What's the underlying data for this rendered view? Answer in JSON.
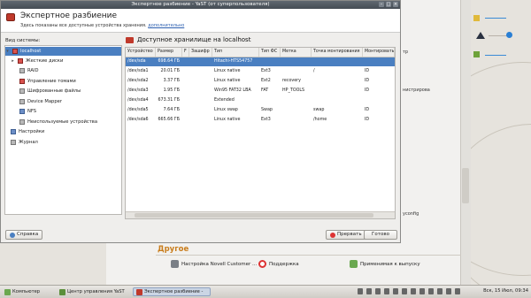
{
  "dialog": {
    "window_title": "Экспертное разбиение - YaST (от суперпользователя)",
    "header_title": "Экспертное разбиение",
    "header_desc": "Здесь показаны все доступные устройства хранения.",
    "header_link": "дополнительно"
  },
  "sidebar": {
    "label": "Вид системы:",
    "items": [
      {
        "label": "localhost"
      },
      {
        "label": "Жесткие диски"
      },
      {
        "label": "RAID"
      },
      {
        "label": "Управление томами"
      },
      {
        "label": "Шифрованные файлы"
      },
      {
        "label": "Device Mapper"
      },
      {
        "label": "NFS"
      },
      {
        "label": "Неиспользуемые устройства"
      },
      {
        "label": "Настройки"
      },
      {
        "label": "Журнал"
      }
    ]
  },
  "panel": {
    "title": "Доступное хранилище на localhost",
    "columns": [
      "Устройство",
      "Размер",
      "F",
      "Зашифр",
      "Тип",
      "Тип ФС",
      "Метка",
      "Точка монтирования",
      "Монтировать по"
    ],
    "rows": [
      {
        "device": "/dev/sda",
        "size": "698.64 ГБ",
        "type": "Hitachi-HTS54757",
        "fs": "",
        "label": "",
        "mount": "",
        "by": ""
      },
      {
        "device": "/dev/sda1",
        "size": "20.01 ГБ",
        "type": "Linux native",
        "fs": "Ext3",
        "label": "",
        "mount": "/",
        "by": "ID"
      },
      {
        "device": "/dev/sda2",
        "size": "3.37 ГБ",
        "type": "Linux native",
        "fs": "Ext2",
        "label": "recovery",
        "mount": "",
        "by": "ID"
      },
      {
        "device": "/dev/sda3",
        "size": "1.95 ГБ",
        "type": "Win95 FAT32 LBA",
        "fs": "FAT",
        "label": "HP_TOOLS",
        "mount": "",
        "by": "ID"
      },
      {
        "device": "/dev/sda4",
        "size": "673.31 ГБ",
        "type": "Extended",
        "fs": "",
        "label": "",
        "mount": "",
        "by": ""
      },
      {
        "device": "/dev/sda5",
        "size": "7.64 ГБ",
        "type": "Linux swap",
        "fs": "Swap",
        "label": "",
        "mount": "swap",
        "by": "ID"
      },
      {
        "device": "/dev/sda6",
        "size": "665.66 ГБ",
        "type": "Linux native",
        "fs": "Ext3",
        "label": "",
        "mount": "/home",
        "by": "ID"
      }
    ]
  },
  "buttons": {
    "help": "Справка",
    "cancel": "Прервать",
    "finish": "Готово"
  },
  "background": {
    "peek": [
      "тр",
      "нистрирова",
      "yconfig"
    ],
    "other_title": "Другое",
    "other_items": [
      {
        "label": "Настройка Novell Customer ..."
      },
      {
        "label": "Поддержка"
      },
      {
        "label": "Применимая к выпуску"
      }
    ]
  },
  "taskbar": {
    "items": [
      {
        "label": "Компьютер"
      },
      {
        "label": "Центр управления YaST"
      },
      {
        "label": "Экспертное разбиение -"
      }
    ],
    "clock": "Вск, 15 Июл, 09:34"
  }
}
